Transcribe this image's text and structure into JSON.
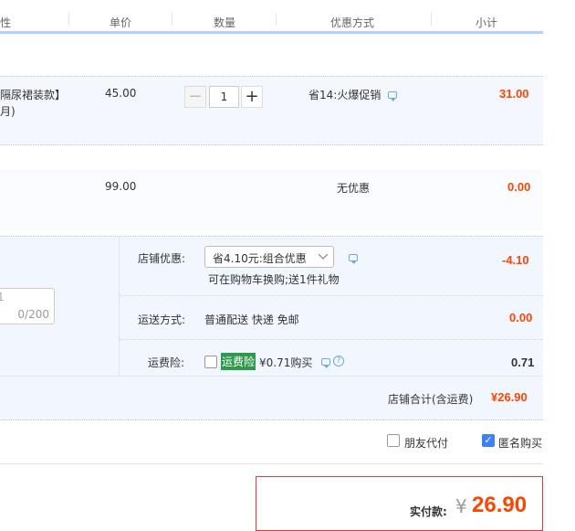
{
  "header": {
    "col_attr": "性",
    "col_price": "单价",
    "col_qty": "数量",
    "col_discount": "优惠方式",
    "col_subtotal": "小计"
  },
  "items": [
    {
      "title_line1": "隔尿裙装款】",
      "title_line2": "月)",
      "price": "45.00",
      "qty": "1",
      "discount": "省14:火爆促销",
      "subtotal": "31.00"
    },
    {
      "price": "99.00",
      "discount": "无优惠",
      "subtotal": "0.00"
    }
  ],
  "shop": {
    "remark_counter": "0/200",
    "remark_partial": "1",
    "promo_label": "店铺优惠:",
    "promo_select": "省4.10元:组合优惠",
    "promo_note": "可在购物车换购;送1件礼物",
    "promo_amount": "-4.10",
    "ship_label": "运送方式:",
    "ship_value": "普通配送 快递 免邮",
    "ship_amount": "0.00",
    "insurance_label": "运费险:",
    "insurance_tag": "运费险",
    "insurance_price": "¥0.71购买",
    "insurance_amount": "0.71",
    "total_label": "店铺合计(含运费)",
    "total_amount": "¥26.90"
  },
  "options": {
    "friend_pay": "朋友代付",
    "anonymous": "匿名购买"
  },
  "payment": {
    "label": "实付款:",
    "currency": "¥",
    "amount": "26.90"
  }
}
